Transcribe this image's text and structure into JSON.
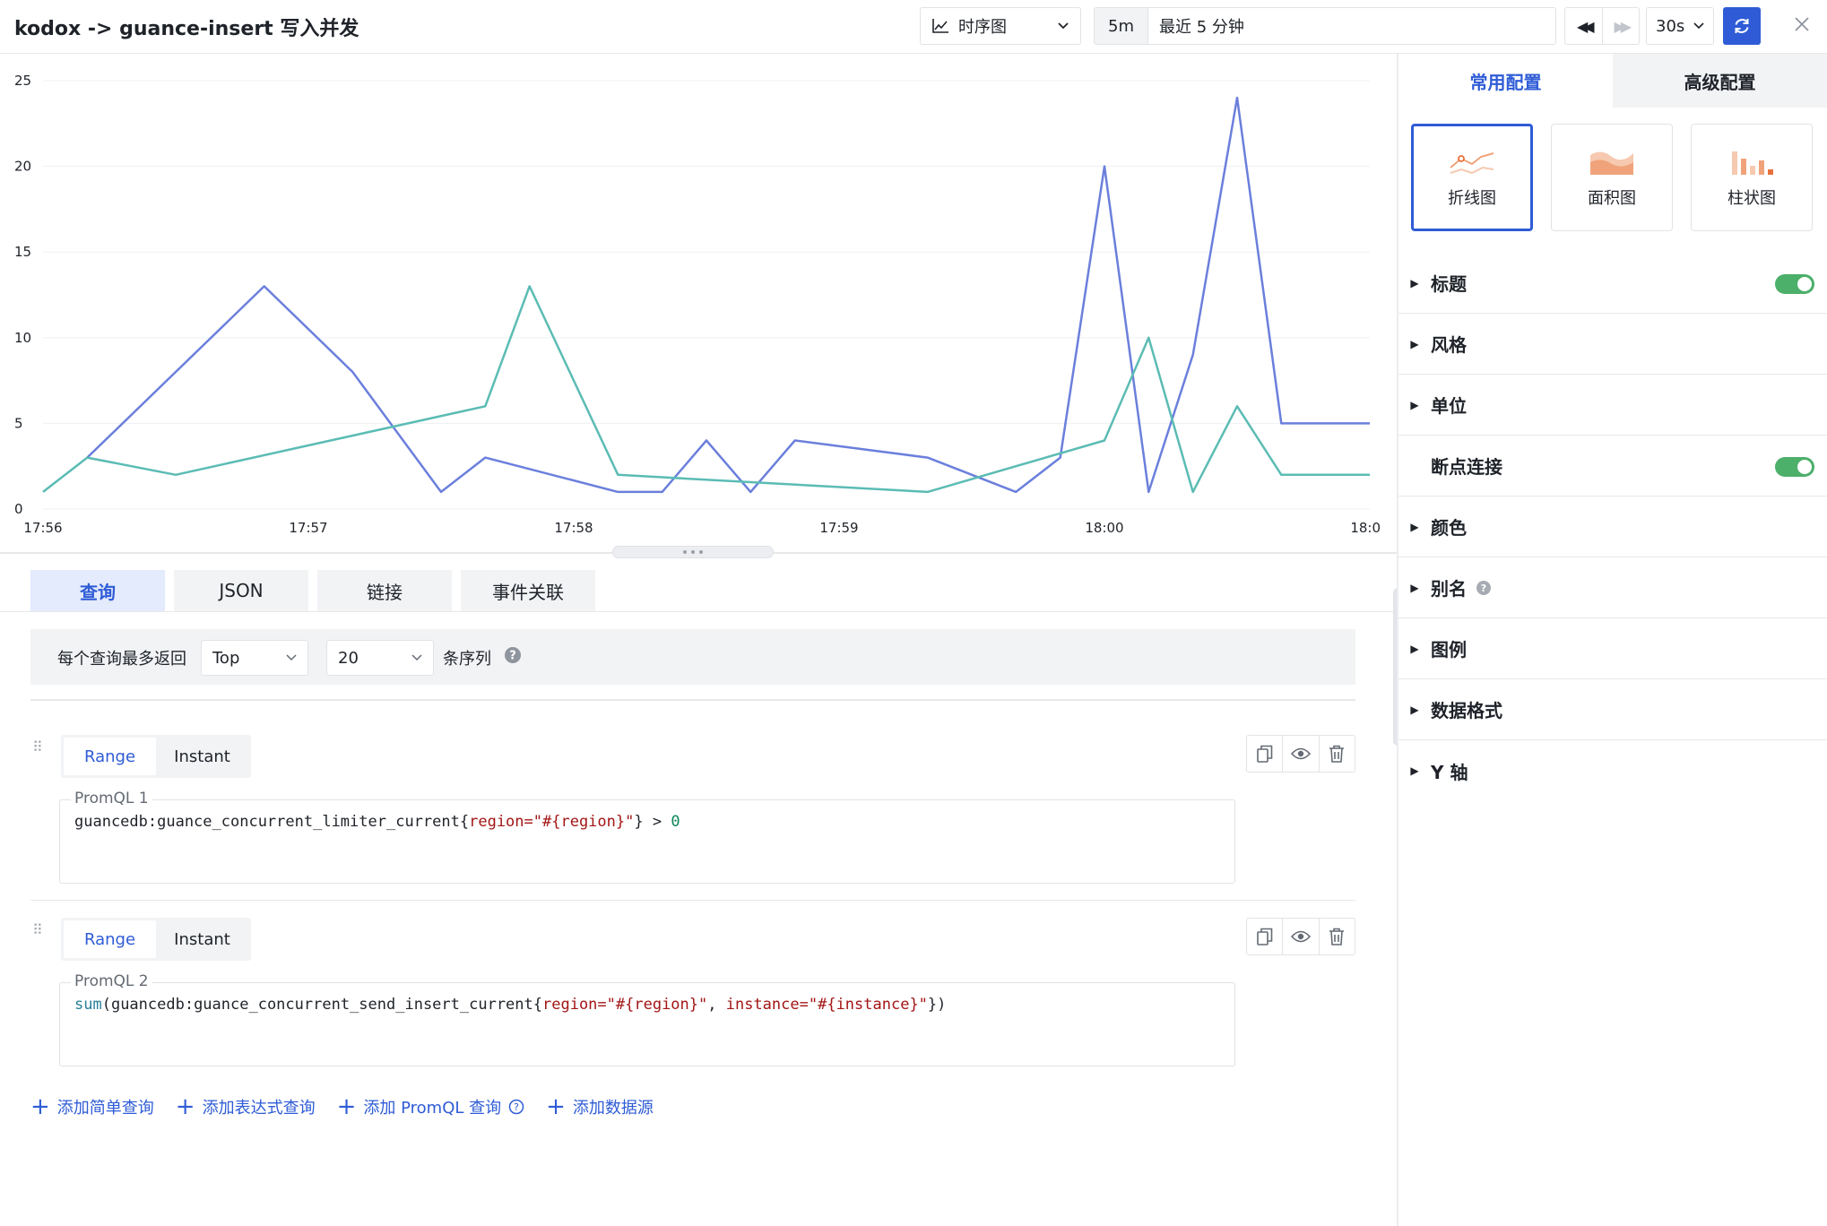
{
  "header": {
    "title": "kodox -> guance-insert 写入并发",
    "viz_type": "时序图",
    "time_short": "5m",
    "time_range": "最近 5 分钟",
    "interval": "30s"
  },
  "chart_data": {
    "type": "line",
    "x": [
      "17:56",
      "17:56:10",
      "17:56:20",
      "17:56:30",
      "17:56:40",
      "17:56:50",
      "17:57",
      "17:57:10",
      "17:57:20",
      "17:57:30",
      "17:57:40",
      "17:57:50",
      "17:58",
      "17:58:10",
      "17:58:20",
      "17:58:30",
      "17:58:40",
      "17:58:50",
      "17:59",
      "17:59:10",
      "17:59:20",
      "17:59:30",
      "17:59:40",
      "17:59:50",
      "18:00",
      "18:00:10",
      "18:00:20",
      "18:00:30",
      "18:00:40",
      "18:00:50",
      "18:01"
    ],
    "x_tick_labels": [
      "17:56",
      "17:57",
      "17:58",
      "17:59",
      "18:00",
      "18:0"
    ],
    "y_ticks": [
      0,
      5,
      10,
      15,
      20,
      25
    ],
    "ylim": [
      0,
      25
    ],
    "grid": true,
    "legend": "none",
    "series": [
      {
        "color": "#6b7fdc",
        "values": [
          null,
          3,
          null,
          8,
          null,
          13,
          null,
          8,
          null,
          1,
          3,
          null,
          null,
          1,
          1,
          4,
          1,
          4,
          null,
          null,
          3,
          null,
          1,
          3,
          20,
          1,
          9,
          24,
          5,
          null,
          5
        ]
      },
      {
        "color": "#5bbcb4",
        "values": [
          1,
          3,
          null,
          2,
          null,
          null,
          null,
          null,
          null,
          null,
          6,
          13,
          null,
          2,
          null,
          null,
          null,
          null,
          null,
          null,
          1,
          null,
          null,
          null,
          4,
          10,
          1,
          6,
          2,
          null,
          2
        ]
      }
    ]
  },
  "tabs": [
    "查询",
    "JSON",
    "链接",
    "事件关联"
  ],
  "limit": {
    "label": "每个查询最多返回",
    "order": "Top",
    "count": "20",
    "unit": "条序列"
  },
  "queries": [
    {
      "mode_range": "Range",
      "mode_instant": "Instant",
      "name": "PromQL 1",
      "code": {
        "p1": "guancedb:guance_concurrent_limiter_current{",
        "k1": "region",
        "s1": "=\"#{region}\"",
        "p2": "} > ",
        "n1": "0"
      }
    },
    {
      "mode_range": "Range",
      "mode_instant": "Instant",
      "name": "PromQL 2",
      "code": {
        "fn": "sum",
        "p1": "(guancedb:guance_concurrent_send_insert_current{",
        "k1": "region",
        "s1": "=\"#{region}\"",
        "p2": ", ",
        "k2": "instance",
        "s2": "=\"#{instance}\"",
        "p3": "})"
      }
    }
  ],
  "add_actions": [
    "添加简单查询",
    "添加表达式查询",
    "添加 PromQL 查询",
    "添加数据源"
  ],
  "settings": {
    "tabs": [
      "常用配置",
      "高级配置"
    ],
    "chart_types": [
      "折线图",
      "面积图",
      "柱状图"
    ],
    "sections": [
      "标题",
      "风格",
      "单位",
      "断点连接",
      "颜色",
      "别名",
      "图例",
      "数据格式",
      "Y 轴"
    ]
  },
  "colors": {
    "accent": "#2f5cd6",
    "toggle_on": "#4caf6a",
    "series_1": "#6b7fdc",
    "series_2": "#5bbcb4"
  }
}
